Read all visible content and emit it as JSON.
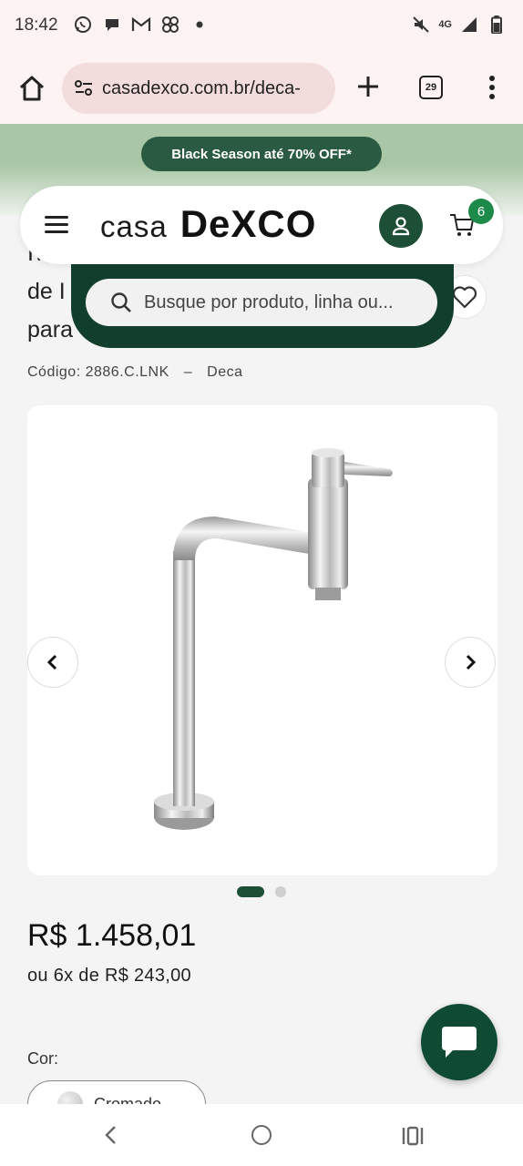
{
  "status_bar": {
    "time": "18:42",
    "left_icons": [
      "whatsapp-icon",
      "chat-bubble-icon",
      "gmail-icon",
      "pinwheel-icon",
      "dot-icon"
    ],
    "network": "4G",
    "right_icons": [
      "mute-icon",
      "signal-icon",
      "battery-icon"
    ]
  },
  "browser": {
    "url": "casadexco.com.br/deca-",
    "tab_count": "29"
  },
  "promo": {
    "label": "Black Season até 70% OFF*"
  },
  "header": {
    "logo_part1": "casa",
    "logo_part2": "DeXCO",
    "cart_count": "6"
  },
  "search": {
    "placeholder": "Busque por produto, linha ou..."
  },
  "product": {
    "title_fragments": [
      "I\\",
      "de I",
      "para"
    ],
    "code": "Código: 2886.C.LNK",
    "separator": "–",
    "brand": "Deca",
    "price": "R$ 1.458,01",
    "installments": "ou 6x de R$ 243,00",
    "color_label": "Cor:",
    "color_option": "Cromado",
    "gallery": {
      "active_index": 1,
      "total": 2
    }
  },
  "colors": {
    "brand_dark_green": "#1d4e36",
    "promo_pill": "#2a5a42",
    "cart_badge": "#1e8a4a"
  }
}
